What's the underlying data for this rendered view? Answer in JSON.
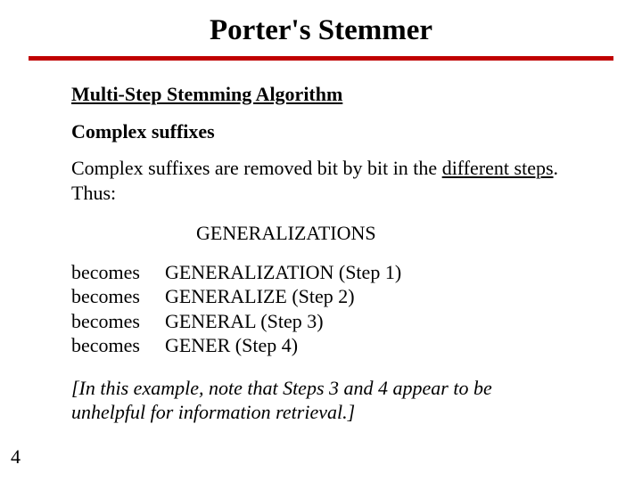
{
  "title": "Porter's Stemmer",
  "subheading": "Multi-Step Stemming Algorithm",
  "section_label": "Complex suffixes",
  "para_lead": "Complex suffixes are removed bit by bit in the ",
  "para_underlined": "different steps",
  "para_tail": ". Thus:",
  "example_word": "GENERALIZATIONS",
  "steps": [
    {
      "left": "becomes",
      "right": "GENERALIZATION (Step 1)"
    },
    {
      "left": "becomes",
      "right": "GENERALIZE (Step 2)"
    },
    {
      "left": "becomes",
      "right": "GENERAL (Step 3)"
    },
    {
      "left": "becomes",
      "right": "GENER (Step 4)"
    }
  ],
  "note": "[In this example, note that Steps 3 and 4 appear to be unhelpful for information retrieval.]",
  "page_number": "4"
}
